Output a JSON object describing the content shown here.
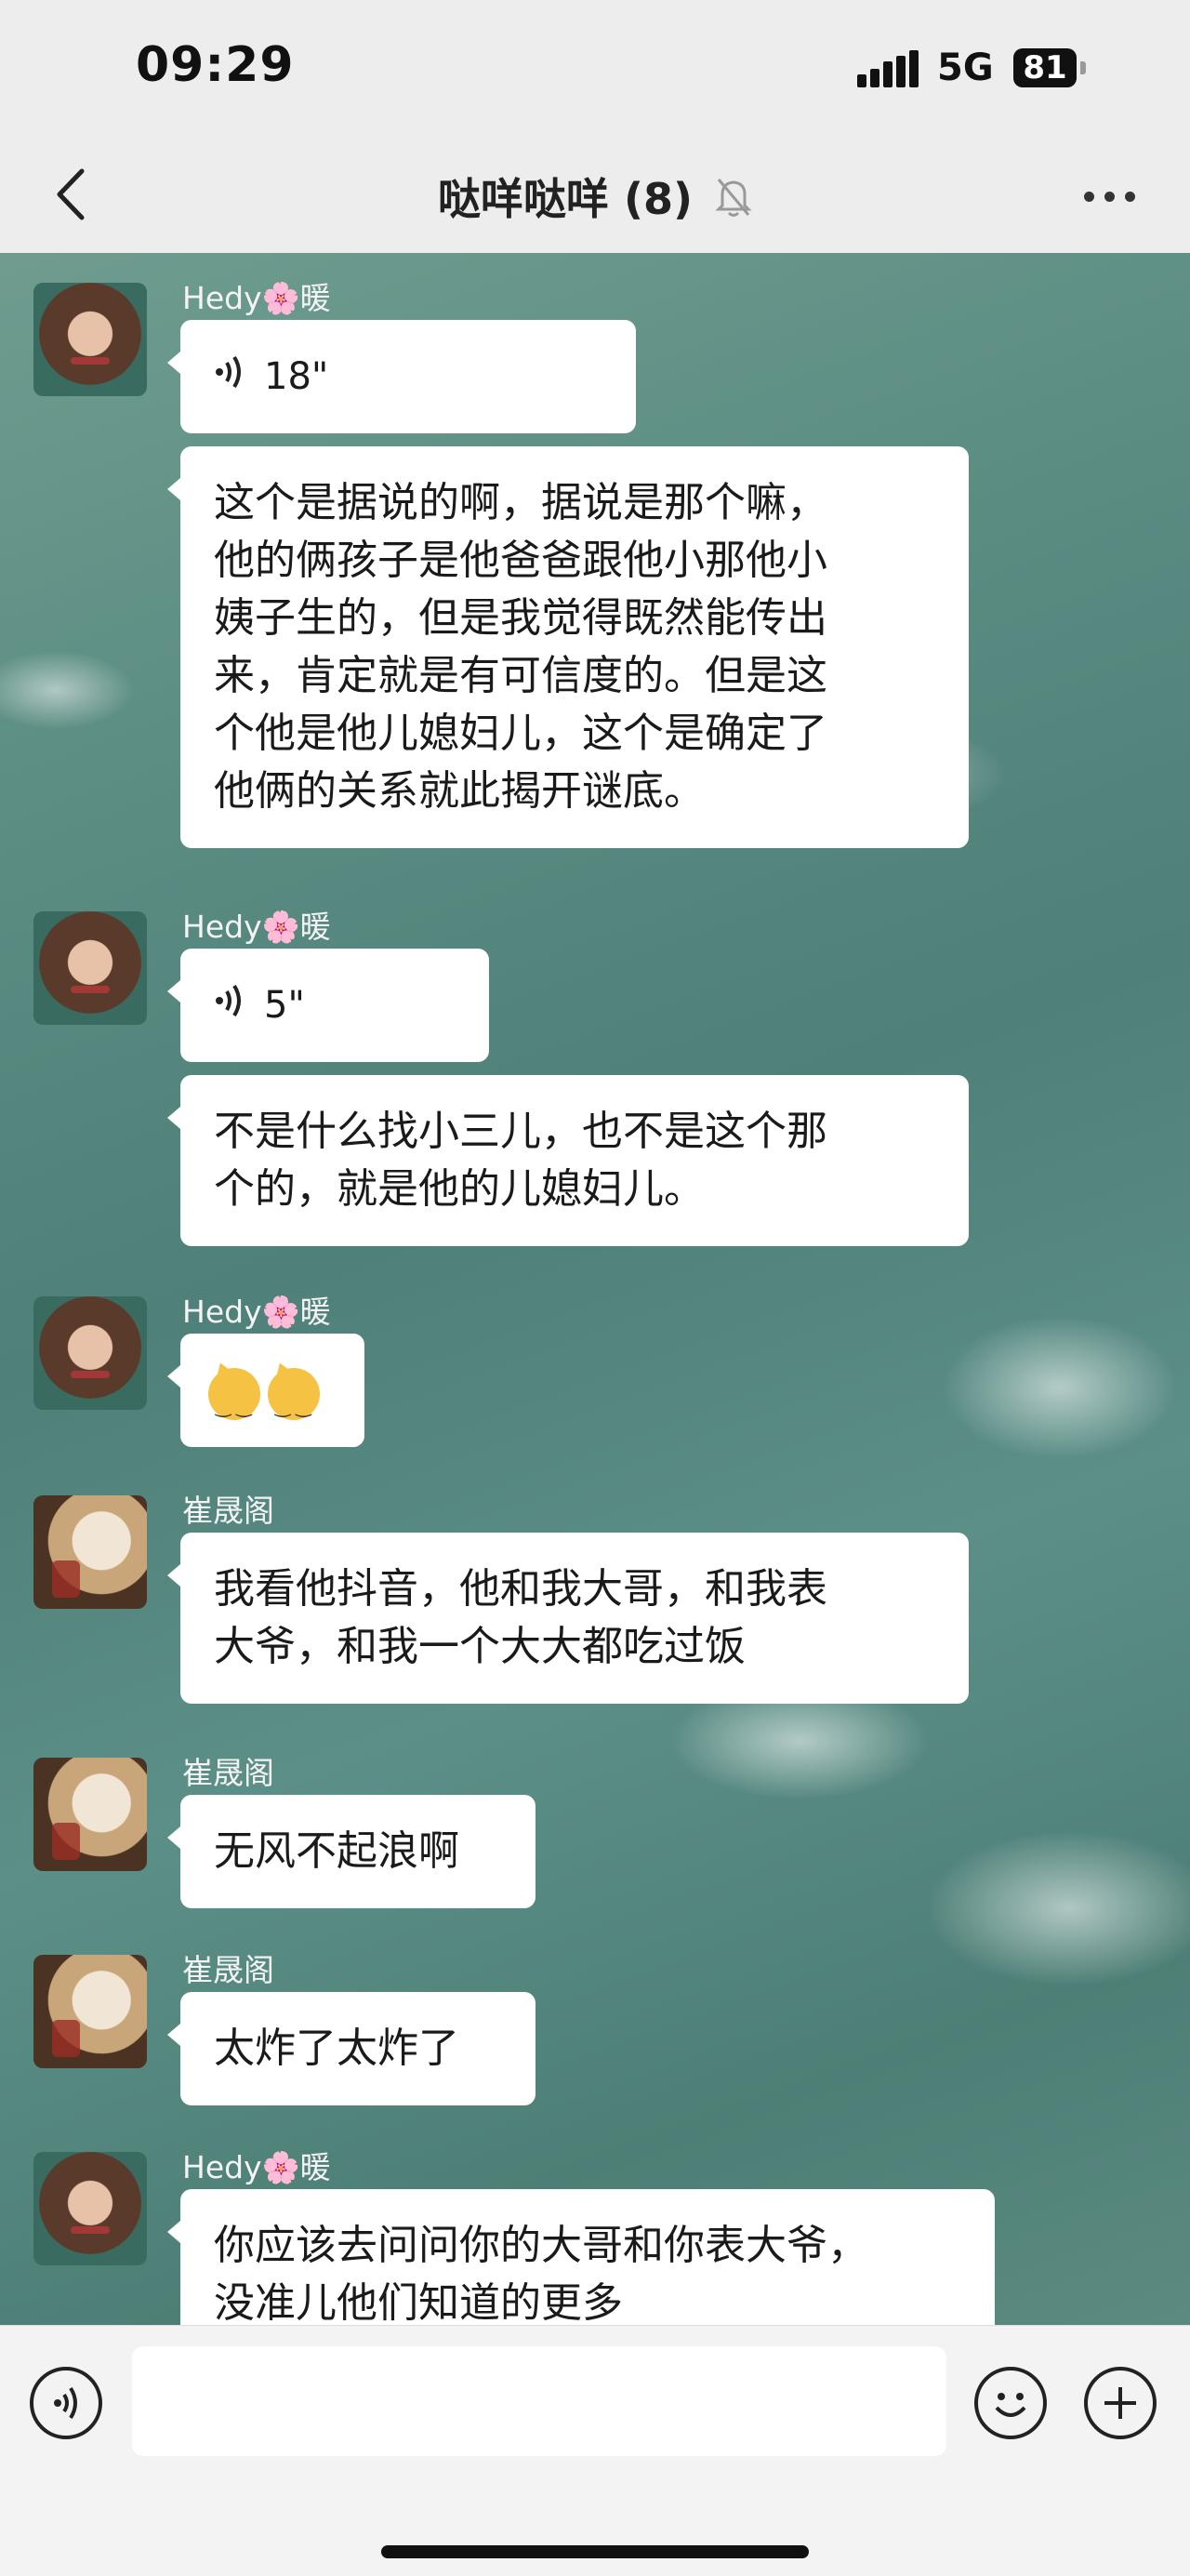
{
  "status_bar": {
    "time": "09:29",
    "network": "5G",
    "battery": "81"
  },
  "header": {
    "title": "哒咩哒咩 (8)"
  },
  "messages": [
    {
      "sender": "Hedy🌸暖",
      "voice_duration": "18\""
    },
    {
      "text": "这个是据说的啊，据说是那个嘛，\n他的俩孩子是他爸爸跟他小那他小\n姨子生的，但是我觉得既然能传出\n来，肯定就是有可信度的。但是这\n个他是他儿媳妇儿，这个是确定了\n他俩的关系就此揭开谜底。"
    },
    {
      "sender": "Hedy🌸暖",
      "voice_duration": "5\""
    },
    {
      "text": "不是什么找小三儿，也不是这个那\n个的，就是他的儿媳妇儿。"
    },
    {
      "sender": "Hedy🌸暖"
    },
    {
      "sender": "崔晟阁",
      "text": "我看他抖音，他和我大哥，和我表\n大爷，和我一个大大都吃过饭"
    },
    {
      "sender": "崔晟阁",
      "text": "无风不起浪啊"
    },
    {
      "sender": "崔晟阁",
      "text": "太炸了太炸了"
    },
    {
      "sender": "Hedy🌸暖",
      "text": "你应该去问问你的大哥和你表大爷，\n没准儿他们知道的更多"
    }
  ],
  "icons": {
    "back": "chevron-left-icon",
    "mute": "bell-off-icon",
    "more": "more-dots-icon",
    "voice_input": "voice-input-icon",
    "emoji": "emoji-icon",
    "add": "plus-icon"
  }
}
